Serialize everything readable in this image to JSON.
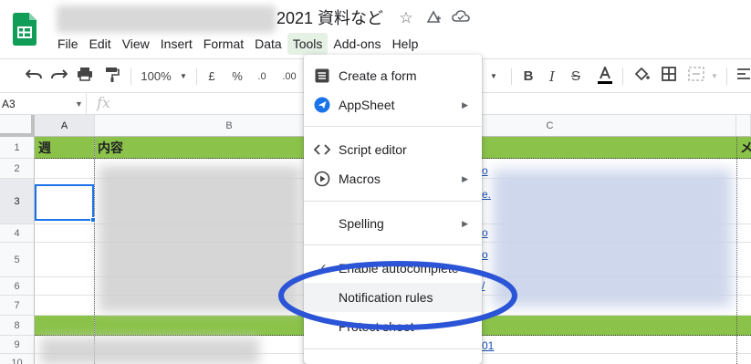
{
  "header": {
    "doc_title": "2021 資料など",
    "star_icon": "star-icon",
    "move_icon": "move-to-drive-icon",
    "cloud_icon": "cloud-status-icon"
  },
  "menubar": {
    "items": [
      "File",
      "Edit",
      "View",
      "Insert",
      "Format",
      "Data",
      "Tools",
      "Add-ons",
      "Help"
    ],
    "active": "Tools"
  },
  "toolbar": {
    "zoom": "100%",
    "currency": "£",
    "percent": "%",
    "decimal_decrease": ".0",
    "decimal_increase": ".00"
  },
  "formula_bar": {
    "cell_ref": "A3",
    "fx": "fx"
  },
  "grid": {
    "columns": [
      "A",
      "B",
      "C"
    ],
    "rows": [
      "1",
      "2",
      "3",
      "4",
      "5",
      "6",
      "7",
      "8",
      "9",
      "10"
    ],
    "header_row": {
      "a": "週",
      "b": "内容",
      "d": "メ"
    }
  },
  "tools_menu": {
    "items": [
      {
        "label": "Create a form",
        "icon": "form-icon",
        "submenu": false
      },
      {
        "label": "AppSheet",
        "icon": "appsheet-icon",
        "submenu": true
      },
      {
        "label": "Script editor",
        "icon": "code-icon",
        "submenu": false
      },
      {
        "label": "Macros",
        "icon": "play-circle-icon",
        "submenu": true
      },
      {
        "label": "Spelling",
        "icon": "",
        "submenu": true
      },
      {
        "label": "Enable autocomplete",
        "icon": "check-icon",
        "submenu": false
      },
      {
        "label": "Notification rules",
        "icon": "",
        "submenu": false
      },
      {
        "label": "Protect sheet",
        "icon": "",
        "submenu": false
      }
    ],
    "highlighted": "Notification rules"
  },
  "colors": {
    "header_green": "#8bc34a",
    "selection_blue": "#1a73e8",
    "annotation_oval": "#2b54d6",
    "sheets_logo": "#0f9d58"
  }
}
